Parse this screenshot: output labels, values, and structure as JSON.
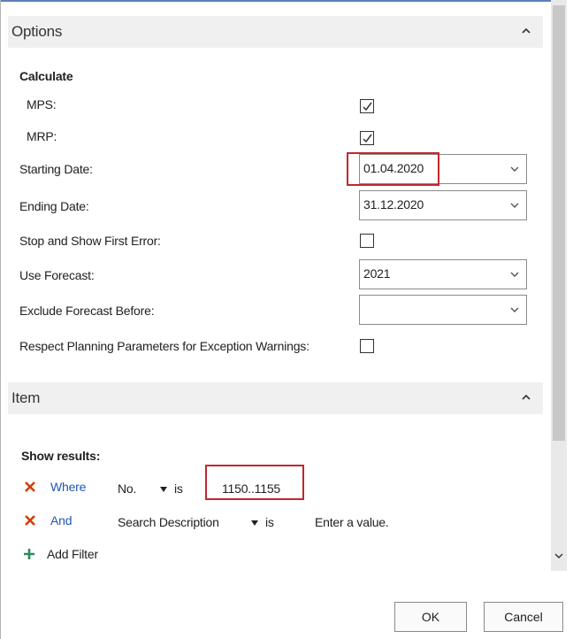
{
  "options": {
    "header": "Options",
    "calculate_label": "Calculate",
    "mps_label": "MPS:",
    "mps_checked": true,
    "mrp_label": "MRP:",
    "mrp_checked": true,
    "starting_date_label": "Starting Date:",
    "starting_date_value": "01.04.2020",
    "ending_date_label": "Ending Date:",
    "ending_date_value": "31.12.2020",
    "stop_first_error_label": "Stop and Show First Error:",
    "stop_first_error_checked": false,
    "use_forecast_label": "Use Forecast:",
    "use_forecast_value": "2021",
    "exclude_forecast_label": "Exclude Forecast Before:",
    "exclude_forecast_value": "",
    "respect_params_label": "Respect Planning Parameters for Exception Warnings:",
    "respect_params_checked": false
  },
  "item": {
    "header": "Item",
    "show_results_label": "Show results:",
    "filters": [
      {
        "connector": "Where",
        "field": "No.",
        "operator": "is",
        "value": "1150..1155"
      },
      {
        "connector": "And",
        "field": "Search Description",
        "operator": "is",
        "value": "Enter a value."
      }
    ],
    "add_filter_label": "Add Filter"
  },
  "buttons": {
    "ok_label": "OK",
    "cancel_label": "Cancel"
  },
  "colors": {
    "accent_blue": "#2057b3",
    "remove_red": "#d83b01",
    "add_green": "#2e8b57",
    "highlight_red": "#c0282d"
  }
}
